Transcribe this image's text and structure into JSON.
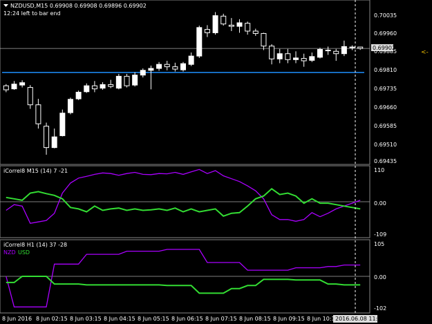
{
  "header": {
    "symbol_line": "NZDUSD,M15  0.69908 0.69908 0.69896 0.69902",
    "timer": "12:24 left to bar end",
    "current_price_label": "0.69902"
  },
  "price_axis": {
    "labels": [
      "0.70035",
      "0.69960",
      "0.69885",
      "0.69810",
      "0.69735",
      "0.69660",
      "0.69585",
      "0.69510",
      "0.69435"
    ]
  },
  "indicator1": {
    "label": "iCorrel8 M15 (14)  7 -21",
    "axis_labels": [
      "110",
      "0.00",
      "-109"
    ]
  },
  "indicator2": {
    "label": "iCorrel8 H1 (14)  37 -28",
    "legend_nzd": "NZD",
    "legend_usd": "USD",
    "axis_labels": [
      "105",
      "0.00",
      "-102"
    ]
  },
  "time_axis": {
    "labels": [
      "8 Jun 2016",
      "8 Jun 02:15",
      "8 Jun 03:15",
      "8 Jun 04:15",
      "8 Jun 05:15",
      "8 Jun 06:15",
      "8 Jun 07:15",
      "8 Jun 08:15",
      "8 Jun 09:15",
      "8 Jun 10:15"
    ],
    "cursor_label": "2016.06.08 11:30"
  },
  "colors": {
    "background": "#000000",
    "candle_up": "#ffffff",
    "candle_down": "#000000",
    "level_line": "#1e90ff",
    "nzd_line": "#aa00ff",
    "usd_line": "#33dd33",
    "grid": "#aaaaaa"
  },
  "chart_data": [
    {
      "type": "candlestick",
      "name": "NZDUSD,M15",
      "x_labels": [
        "8 Jun 2016",
        "8 Jun 02:15",
        "8 Jun 03:15",
        "8 Jun 04:15",
        "8 Jun 05:15",
        "8 Jun 06:15",
        "8 Jun 07:15",
        "8 Jun 08:15",
        "8 Jun 09:15",
        "8 Jun 10:15"
      ],
      "ylim": [
        0.6942,
        0.701
      ],
      "candles": [
        {
          "o": 0.69745,
          "h": 0.69752,
          "l": 0.69718,
          "c": 0.69728
        },
        {
          "o": 0.69732,
          "h": 0.69765,
          "l": 0.69728,
          "c": 0.69752
        },
        {
          "o": 0.69748,
          "h": 0.69768,
          "l": 0.69738,
          "c": 0.69758
        },
        {
          "o": 0.69738,
          "h": 0.69748,
          "l": 0.69648,
          "c": 0.69665
        },
        {
          "o": 0.69665,
          "h": 0.6969,
          "l": 0.69565,
          "c": 0.69585
        },
        {
          "o": 0.69575,
          "h": 0.6959,
          "l": 0.69455,
          "c": 0.69485
        },
        {
          "o": 0.69485,
          "h": 0.69565,
          "l": 0.69482,
          "c": 0.6953
        },
        {
          "o": 0.69535,
          "h": 0.69645,
          "l": 0.69532,
          "c": 0.6963
        },
        {
          "o": 0.69632,
          "h": 0.69695,
          "l": 0.69625,
          "c": 0.69688
        },
        {
          "o": 0.6969,
          "h": 0.69725,
          "l": 0.69685,
          "c": 0.69718
        },
        {
          "o": 0.6972,
          "h": 0.69755,
          "l": 0.69715,
          "c": 0.69745
        },
        {
          "o": 0.69745,
          "h": 0.69765,
          "l": 0.69718,
          "c": 0.69732
        },
        {
          "o": 0.69735,
          "h": 0.6976,
          "l": 0.69728,
          "c": 0.6975
        },
        {
          "o": 0.6975,
          "h": 0.6977,
          "l": 0.69735,
          "c": 0.69742
        },
        {
          "o": 0.69735,
          "h": 0.69795,
          "l": 0.6973,
          "c": 0.69785
        },
        {
          "o": 0.69785,
          "h": 0.69795,
          "l": 0.69738,
          "c": 0.69745
        },
        {
          "o": 0.69748,
          "h": 0.69802,
          "l": 0.69742,
          "c": 0.6979
        },
        {
          "o": 0.6979,
          "h": 0.69818,
          "l": 0.6978,
          "c": 0.6981
        },
        {
          "o": 0.6981,
          "h": 0.6983,
          "l": 0.6973,
          "c": 0.69818
        },
        {
          "o": 0.69818,
          "h": 0.69845,
          "l": 0.69808,
          "c": 0.69835
        },
        {
          "o": 0.69835,
          "h": 0.6985,
          "l": 0.6981,
          "c": 0.69825
        },
        {
          "o": 0.69825,
          "h": 0.69842,
          "l": 0.69805,
          "c": 0.69815
        },
        {
          "o": 0.69812,
          "h": 0.69845,
          "l": 0.69805,
          "c": 0.69838
        },
        {
          "o": 0.69835,
          "h": 0.69885,
          "l": 0.69828,
          "c": 0.6987
        },
        {
          "o": 0.6987,
          "h": 0.69998,
          "l": 0.69862,
          "c": 0.6999
        },
        {
          "o": 0.69982,
          "h": 0.7,
          "l": 0.6995,
          "c": 0.69968
        },
        {
          "o": 0.69968,
          "h": 0.70055,
          "l": 0.6996,
          "c": 0.7004
        },
        {
          "o": 0.70038,
          "h": 0.70048,
          "l": 0.69998,
          "c": 0.70005
        },
        {
          "o": 0.7,
          "h": 0.7003,
          "l": 0.69975,
          "c": 0.69995
        },
        {
          "o": 0.69995,
          "h": 0.70025,
          "l": 0.69968,
          "c": 0.7001
        },
        {
          "o": 0.70008,
          "h": 0.70015,
          "l": 0.6996,
          "c": 0.69975
        },
        {
          "o": 0.69975,
          "h": 0.69985,
          "l": 0.69955,
          "c": 0.69965
        },
        {
          "o": 0.69965,
          "h": 0.69968,
          "l": 0.69895,
          "c": 0.69912
        },
        {
          "o": 0.69912,
          "h": 0.6992,
          "l": 0.69835,
          "c": 0.69858
        },
        {
          "o": 0.69858,
          "h": 0.699,
          "l": 0.6984,
          "c": 0.6988
        },
        {
          "o": 0.6988,
          "h": 0.699,
          "l": 0.6984,
          "c": 0.69855
        },
        {
          "o": 0.69855,
          "h": 0.6989,
          "l": 0.6984,
          "c": 0.69862
        },
        {
          "o": 0.6986,
          "h": 0.6988,
          "l": 0.69825,
          "c": 0.6985
        },
        {
          "o": 0.69852,
          "h": 0.69885,
          "l": 0.69845,
          "c": 0.69868
        },
        {
          "o": 0.69865,
          "h": 0.69905,
          "l": 0.6986,
          "c": 0.69898
        },
        {
          "o": 0.69895,
          "h": 0.6991,
          "l": 0.69875,
          "c": 0.69892
        },
        {
          "o": 0.6989,
          "h": 0.699,
          "l": 0.6985,
          "c": 0.6988
        },
        {
          "o": 0.6988,
          "h": 0.69935,
          "l": 0.6987,
          "c": 0.6991
        },
        {
          "o": 0.69908,
          "h": 0.69915,
          "l": 0.69895,
          "c": 0.69905
        },
        {
          "o": 0.69908,
          "h": 0.69908,
          "l": 0.69896,
          "c": 0.69902
        }
      ],
      "level_line": 0.69801,
      "current_price_line": 0.69902
    },
    {
      "type": "line",
      "name": "iCorrel8 M15 (14)",
      "ylim": [
        -120,
        120
      ],
      "zero_line": 0,
      "series": [
        {
          "name": "NZD",
          "values": [
            -30,
            -10,
            -15,
            -75,
            -70,
            -65,
            -40,
            30,
            65,
            82,
            88,
            95,
            100,
            98,
            92,
            98,
            102,
            95,
            94,
            98,
            97,
            102,
            95,
            104,
            112,
            98,
            108,
            90,
            80,
            70,
            55,
            38,
            10,
            -45,
            -62,
            -62,
            -68,
            -62,
            -38,
            -52,
            -40,
            -25,
            -15,
            -5,
            5
          ]
        },
        {
          "name": "USD",
          "values": [
            15,
            10,
            5,
            30,
            35,
            28,
            22,
            10,
            -20,
            -25,
            -35,
            -15,
            -30,
            -25,
            -22,
            -30,
            -25,
            -30,
            -28,
            -25,
            -30,
            -22,
            -35,
            -25,
            -35,
            -30,
            -25,
            -50,
            -40,
            -38,
            -15,
            10,
            20,
            45,
            25,
            30,
            20,
            -5,
            10,
            -5,
            -5,
            -10,
            -15,
            -20,
            -25
          ]
        }
      ]
    },
    {
      "type": "line",
      "name": "iCorrel8 H1 (14)",
      "ylim": [
        -115,
        115
      ],
      "zero_line": 0,
      "series": [
        {
          "name": "NZD",
          "values": [
            0,
            -100,
            -100,
            -100,
            -100,
            -100,
            40,
            40,
            40,
            40,
            72,
            72,
            72,
            72,
            72,
            82,
            82,
            82,
            82,
            82,
            88,
            88,
            88,
            88,
            88,
            45,
            45,
            45,
            45,
            45,
            20,
            20,
            20,
            20,
            20,
            20,
            28,
            28,
            28,
            28,
            32,
            32,
            37,
            37,
            37
          ]
        },
        {
          "name": "USD",
          "values": [
            -20,
            -20,
            0,
            0,
            0,
            0,
            -25,
            -25,
            -25,
            -25,
            -28,
            -28,
            -28,
            -28,
            -28,
            -28,
            -28,
            -28,
            -28,
            -28,
            -30,
            -30,
            -30,
            -30,
            -55,
            -55,
            -55,
            -55,
            -40,
            -40,
            -30,
            -30,
            -10,
            -10,
            -10,
            -10,
            -12,
            -12,
            -12,
            -12,
            -25,
            -25,
            -28,
            -28,
            -28
          ]
        }
      ]
    }
  ]
}
